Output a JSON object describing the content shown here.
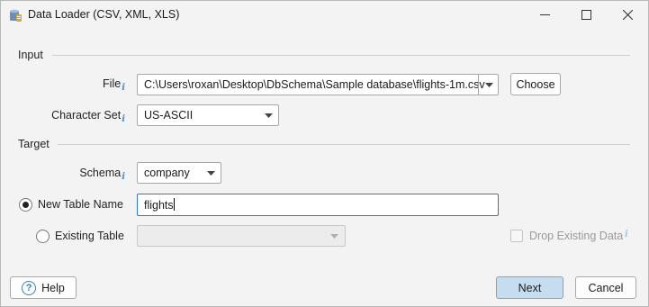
{
  "window": {
    "title": "Data Loader (CSV, XML, XLS)"
  },
  "input_section": {
    "label": "Input",
    "file_label": "File",
    "file_value": "C:\\Users\\roxan\\Desktop\\DbSchema\\Sample database\\flights-1m.csv",
    "choose_label": "Choose",
    "charset_label": "Character Set",
    "charset_value": "US-ASCII"
  },
  "target_section": {
    "label": "Target",
    "schema_label": "Schema",
    "schema_value": "company",
    "new_table_label": "New Table Name",
    "new_table_value": "flights",
    "new_table_selected": true,
    "existing_table_label": "Existing Table",
    "existing_table_value": "",
    "drop_existing_label": "Drop Existing Data",
    "drop_existing_checked": false
  },
  "footer": {
    "help_label": "Help",
    "next_label": "Next",
    "cancel_label": "Cancel"
  },
  "colors": {
    "accent": "#2f78c4",
    "primary_button_bg": "#c6ddf0",
    "info_icon": "#4a8bd0"
  }
}
